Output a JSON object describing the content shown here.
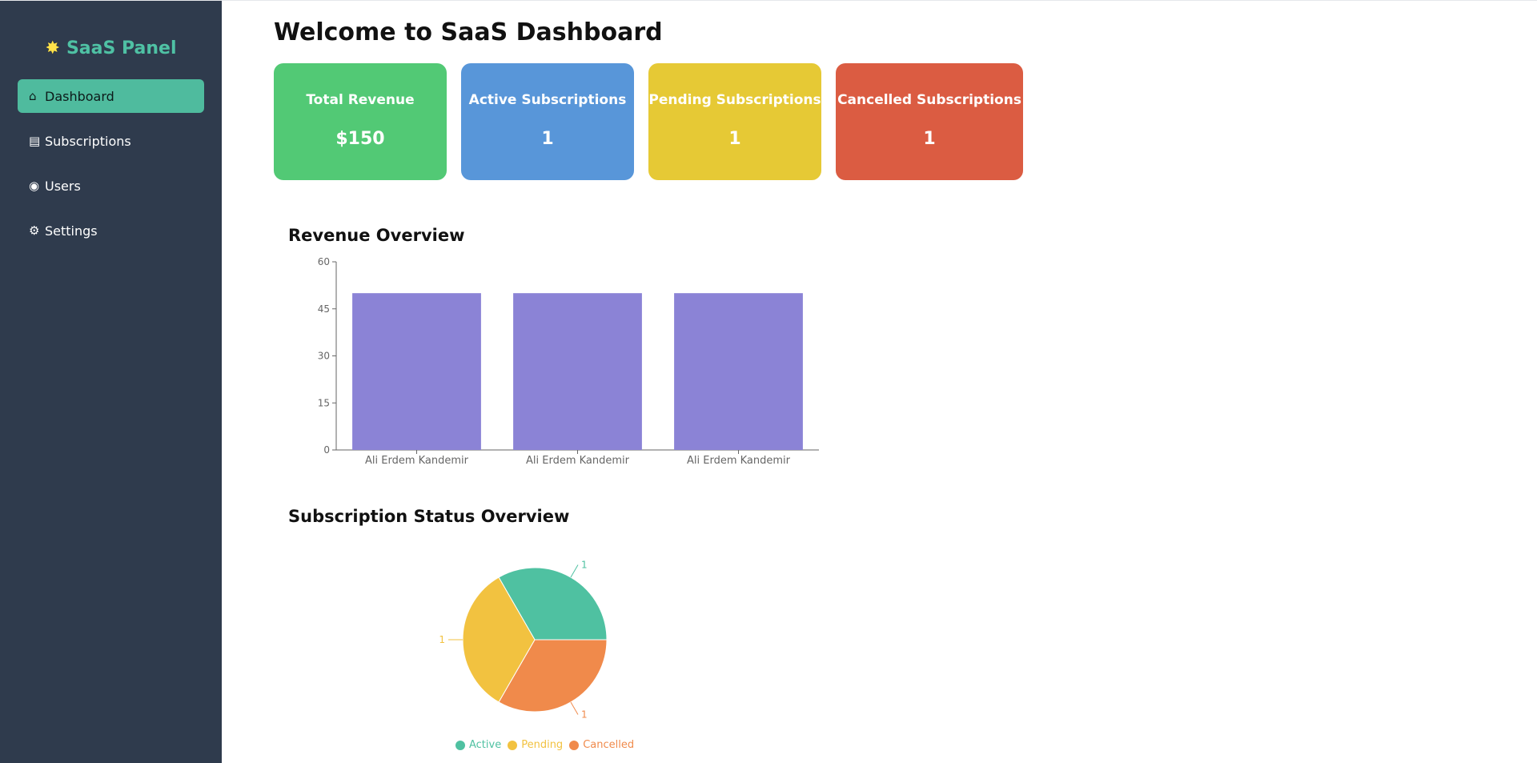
{
  "sidebar": {
    "brand": {
      "icon": "star-icon",
      "label": "SaaS Panel"
    },
    "items": [
      {
        "icon": "home-icon",
        "glyph": "⌂",
        "label": "Dashboard",
        "active": true
      },
      {
        "icon": "clipboard-icon",
        "glyph": "▤",
        "label": "Subscriptions",
        "active": false
      },
      {
        "icon": "users-icon",
        "glyph": "◉",
        "label": "Users",
        "active": false
      },
      {
        "icon": "gear-icon",
        "glyph": "⚙",
        "label": "Settings",
        "active": false
      }
    ]
  },
  "header": {
    "title": "Welcome to SaaS Dashboard"
  },
  "cards": [
    {
      "label": "Total Revenue",
      "value": "$150",
      "color": "#52c975"
    },
    {
      "label": "Active Subscriptions",
      "value": "1",
      "color": "#5896d9"
    },
    {
      "label": "Pending Subscriptions",
      "value": "1",
      "color": "#e6c935"
    },
    {
      "label": "Cancelled Subscriptions",
      "value": "1",
      "color": "#db5c42"
    }
  ],
  "revenue": {
    "title": "Revenue Overview",
    "chart_data": {
      "type": "bar",
      "categories": [
        "Ali Erdem Kandemir",
        "Ali Erdem Kandemir",
        "Ali Erdem Kandemir"
      ],
      "values": [
        50,
        50,
        50
      ],
      "ylim": [
        0,
        60
      ],
      "yticks": [
        0,
        15,
        30,
        45,
        60
      ],
      "color": "#8b83d6",
      "grid": false
    }
  },
  "status": {
    "title": "Subscription Status Overview",
    "chart_data": {
      "type": "pie",
      "slices": [
        {
          "name": "Active",
          "value": 1,
          "color": "#4fc1a1"
        },
        {
          "name": "Pending",
          "value": 1,
          "color": "#f2c240"
        },
        {
          "name": "Cancelled",
          "value": 1,
          "color": "#f08a4b"
        }
      ],
      "legend": "bottom"
    }
  }
}
